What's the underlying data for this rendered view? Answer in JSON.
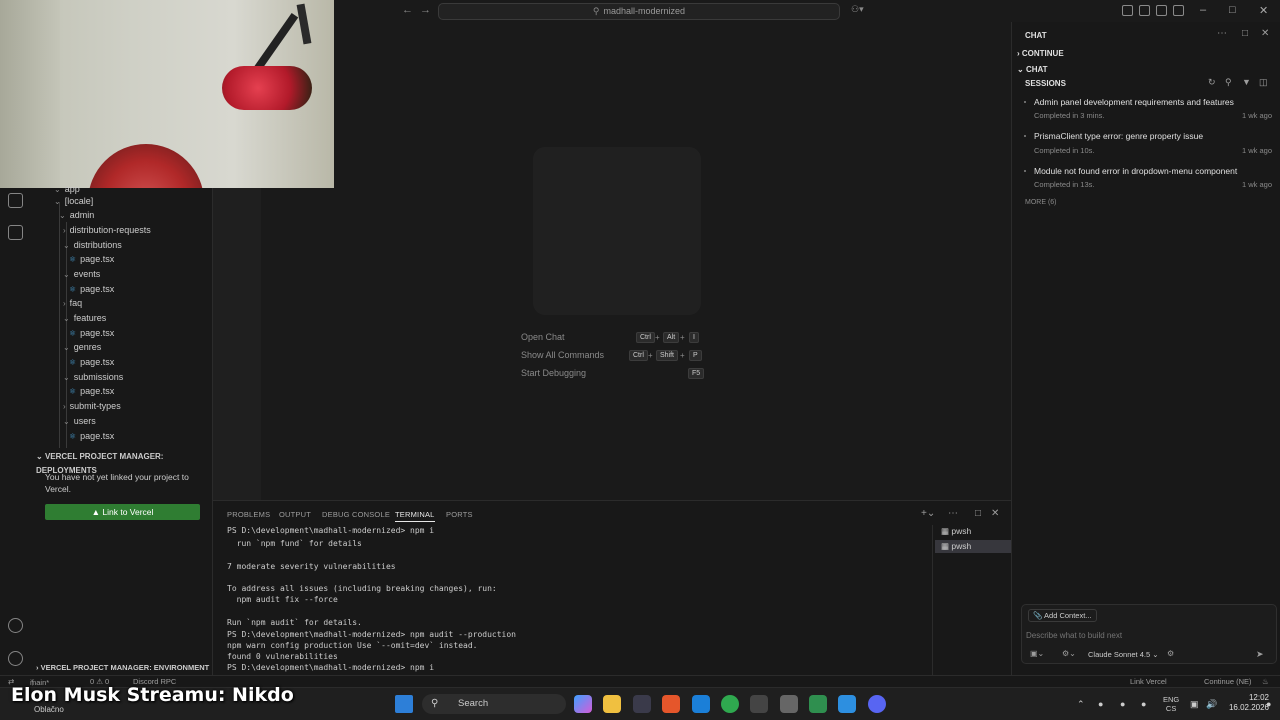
{
  "titlebar": {
    "search_text": "madhall-modernized"
  },
  "sidebar": {
    "tree": [
      {
        "label": "app",
        "kind": "folder"
      },
      {
        "label": "[locale]",
        "kind": "folder"
      },
      {
        "label": "admin",
        "kind": "folder"
      },
      {
        "label": "distribution-requests",
        "kind": "folder"
      },
      {
        "label": "distributions",
        "kind": "folder"
      },
      {
        "label": "page.tsx",
        "kind": "file"
      },
      {
        "label": "events",
        "kind": "folder"
      },
      {
        "label": "page.tsx",
        "kind": "file"
      },
      {
        "label": "faq",
        "kind": "folder"
      },
      {
        "label": "features",
        "kind": "folder"
      },
      {
        "label": "page.tsx",
        "kind": "file"
      },
      {
        "label": "genres",
        "kind": "folder"
      },
      {
        "label": "page.tsx",
        "kind": "file"
      },
      {
        "label": "submissions",
        "kind": "folder"
      },
      {
        "label": "page.tsx",
        "kind": "file"
      },
      {
        "label": "submit-types",
        "kind": "folder"
      },
      {
        "label": "users",
        "kind": "folder"
      },
      {
        "label": "page.tsx",
        "kind": "file"
      }
    ],
    "vercel_header": "VERCEL PROJECT MANAGER: DEPLOYMENTS",
    "vercel_message": "You have not yet linked your project to Vercel.",
    "link_button": "Link to Vercel",
    "vercel_env": "VERCEL PROJECT MANAGER: ENVIRONMENT ..."
  },
  "editor": {
    "hints": [
      {
        "label": "Open Chat",
        "keys": [
          "Ctrl",
          "Alt",
          "I"
        ]
      },
      {
        "label": "Show All Commands",
        "keys": [
          "Ctrl",
          "Shift",
          "P"
        ]
      },
      {
        "label": "Start Debugging",
        "keys": [
          "F5"
        ]
      }
    ]
  },
  "panel": {
    "tabs": [
      "PROBLEMS",
      "OUTPUT",
      "DEBUG CONSOLE",
      "TERMINAL",
      "PORTS"
    ],
    "active_tab": "TERMINAL",
    "terminal_lines": [
      "PS D:\\development\\madhall-modernized> npm i",
      "  run `npm fund` for details",
      "",
      "7 moderate severity vulnerabilities",
      "",
      "To address all issues (including breaking changes), run:",
      "  npm audit fix --force",
      "",
      "Run `npm audit` for details.",
      "PS D:\\development\\madhall-modernized> npm audit --production",
      "npm warn config production Use `--omit=dev` instead.",
      "found 0 vulnerabilities",
      "PS D:\\development\\madhall-modernized> npm i"
    ],
    "terminals": [
      "pwsh",
      "pwsh"
    ]
  },
  "chat": {
    "title": "CHAT",
    "continue_label": "CONTINUE",
    "chat_label": "CHAT",
    "sessions_label": "SESSIONS",
    "sessions": [
      {
        "title": "Admin panel development requirements and features",
        "status": "Completed in 3 mins.",
        "age": "1 wk ago"
      },
      {
        "title": "PrismaClient type error: genre property issue",
        "status": "Completed in 10s.",
        "age": "1 wk ago"
      },
      {
        "title": "Module not found error in dropdown-menu component",
        "status": "Completed in 13s.",
        "age": "1 wk ago"
      }
    ],
    "more_label": "MORE (6)",
    "add_context": "Add Context...",
    "input_placeholder": "Describe what to build next",
    "model": "Claude Sonnet 4.5"
  },
  "statusbar": {
    "branch": "main*",
    "problems": "0 ⚠ 0",
    "discord": "Discord RPC",
    "link_vercel": "Link Vercel",
    "continue_ne": "Continue (NE)"
  },
  "taskbar": {
    "overlay_text": "Elon Musk Streamu: Nikdo",
    "weather": "Oblačno",
    "search_label": "Search",
    "lang_top": "ENG",
    "lang_bottom": "CS",
    "time": "12:02",
    "date": "16.02.2026"
  }
}
